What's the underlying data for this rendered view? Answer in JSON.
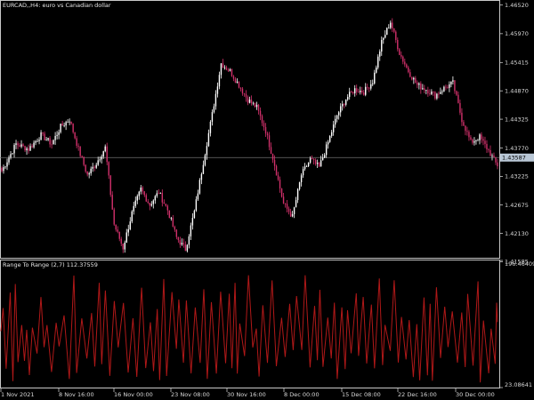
{
  "header": {
    "symbol_line": "EURCAD,,H4:  euro vs Canadian dollar",
    "indicator_line": "Range To Range (2,7) 112.37559"
  },
  "colors": {
    "background": "#000000",
    "frame": "#c8c8c8",
    "bull_candle": "#ffffff",
    "bear_candle": "#d0306a",
    "indicator_line": "#b01818",
    "current_price_line": "#707070",
    "current_price_tag": "#b9c7d6"
  },
  "current_price_tag": "1.43587",
  "chart_data": [
    {
      "type": "candlestick",
      "title": "EURCAD,,H4:  euro vs Canadian dollar",
      "ylim": [
        1.4166,
        1.466
      ],
      "y_ticks": [
        "1.46520",
        "1.45970",
        "1.45415",
        "1.44870",
        "1.44325",
        "1.43770",
        "1.43225",
        "1.42675",
        "1.42130",
        "1.41585"
      ],
      "last_price": 1.43587,
      "close_path": [
        {
          "bar": 0,
          "price": 1.4333
        },
        {
          "bar": 8,
          "price": 1.4385
        },
        {
          "bar": 15,
          "price": 1.4375
        },
        {
          "bar": 22,
          "price": 1.4402
        },
        {
          "bar": 28,
          "price": 1.4385
        },
        {
          "bar": 33,
          "price": 1.4418
        },
        {
          "bar": 38,
          "price": 1.4432
        },
        {
          "bar": 43,
          "price": 1.4375
        },
        {
          "bar": 48,
          "price": 1.4325
        },
        {
          "bar": 53,
          "price": 1.4348
        },
        {
          "bar": 58,
          "price": 1.4378
        },
        {
          "bar": 63,
          "price": 1.423
        },
        {
          "bar": 68,
          "price": 1.4185
        },
        {
          "bar": 73,
          "price": 1.4252
        },
        {
          "bar": 78,
          "price": 1.4298
        },
        {
          "bar": 83,
          "price": 1.4268
        },
        {
          "bar": 88,
          "price": 1.4292
        },
        {
          "bar": 93,
          "price": 1.4258
        },
        {
          "bar": 98,
          "price": 1.4205
        },
        {
          "bar": 103,
          "price": 1.4182
        },
        {
          "bar": 108,
          "price": 1.4255
        },
        {
          "bar": 113,
          "price": 1.435
        },
        {
          "bar": 118,
          "price": 1.4442
        },
        {
          "bar": 123,
          "price": 1.454
        },
        {
          "bar": 128,
          "price": 1.4525
        },
        {
          "bar": 133,
          "price": 1.4498
        },
        {
          "bar": 138,
          "price": 1.447
        },
        {
          "bar": 143,
          "price": 1.4455
        },
        {
          "bar": 148,
          "price": 1.441
        },
        {
          "bar": 153,
          "price": 1.4345
        },
        {
          "bar": 158,
          "price": 1.427
        },
        {
          "bar": 163,
          "price": 1.4245
        },
        {
          "bar": 168,
          "price": 1.4325
        },
        {
          "bar": 173,
          "price": 1.4355
        },
        {
          "bar": 178,
          "price": 1.434
        },
        {
          "bar": 183,
          "price": 1.4388
        },
        {
          "bar": 188,
          "price": 1.444
        },
        {
          "bar": 193,
          "price": 1.4472
        },
        {
          "bar": 198,
          "price": 1.449
        },
        {
          "bar": 203,
          "price": 1.4485
        },
        {
          "bar": 208,
          "price": 1.4505
        },
        {
          "bar": 213,
          "price": 1.458
        },
        {
          "bar": 218,
          "price": 1.462
        },
        {
          "bar": 223,
          "price": 1.456
        },
        {
          "bar": 228,
          "price": 1.4525
        },
        {
          "bar": 233,
          "price": 1.4498
        },
        {
          "bar": 238,
          "price": 1.449
        },
        {
          "bar": 243,
          "price": 1.4478
        },
        {
          "bar": 248,
          "price": 1.4492
        },
        {
          "bar": 253,
          "price": 1.4502
        },
        {
          "bar": 258,
          "price": 1.4432
        },
        {
          "bar": 263,
          "price": 1.4388
        },
        {
          "bar": 268,
          "price": 1.4398
        },
        {
          "bar": 273,
          "price": 1.4372
        },
        {
          "bar": 278,
          "price": 1.4342
        }
      ]
    },
    {
      "type": "line",
      "title": "Range To Range (2,7) 112.37559",
      "series": [
        {
          "name": "Range To Range (2,7)"
        }
      ],
      "ylim": [
        23.08641,
        196.46409
      ],
      "y_ticks": [
        "196.46409",
        "23.08641"
      ],
      "last_value": 112.37559,
      "x_tick_labels": [
        "1 Nov 2021",
        "8 Nov 16:00",
        "16 Nov 00:00",
        "23 Nov 08:00",
        "30 Nov 16:00",
        "8 Dec 00:00",
        "15 Dec 08:00",
        "22 Dec 16:00",
        "30 Dec 00:00"
      ]
    }
  ]
}
